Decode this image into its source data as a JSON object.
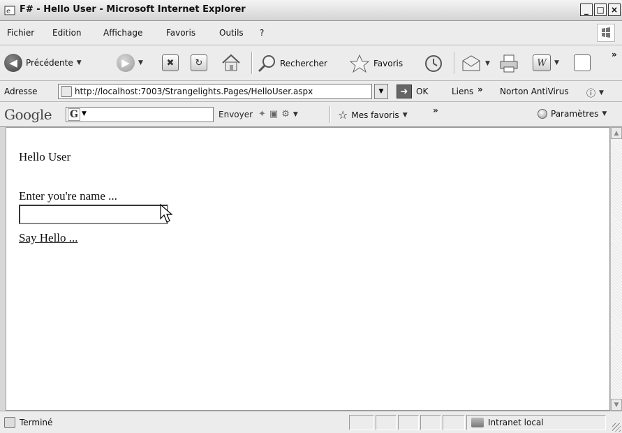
{
  "window": {
    "title": "F# - Hello User - Microsoft Internet Explorer",
    "controls": {
      "minimize": "_",
      "maximize": "□",
      "close": "×"
    }
  },
  "menu": [
    "Fichier",
    "Edition",
    "Affichage",
    "Favoris",
    "Outils",
    "?"
  ],
  "toolbar": {
    "back": "Précédente",
    "search": "Rechercher",
    "favorites": "Favoris",
    "overflow": "»"
  },
  "address": {
    "label": "Adresse",
    "url": "http://localhost:7003/Strangelights.Pages/HelloUser.aspx",
    "go": "OK",
    "links": "Liens",
    "links_more": "»",
    "norton": "Norton AntiVirus"
  },
  "google_toolbar": {
    "logo": "Google",
    "search_mark": "G",
    "send": "Envoyer",
    "favorites": "Mes favoris",
    "more": "»",
    "settings": "Paramètres"
  },
  "page": {
    "heading": "Hello User",
    "prompt": "Enter you're name ...",
    "input_value": "",
    "link": "Say Hello ..."
  },
  "status": {
    "text": "Terminé",
    "zone": "Intranet local"
  },
  "icons": {
    "back": "back-arrow-icon",
    "forward": "forward-arrow-icon",
    "stop": "stop-icon",
    "refresh": "refresh-icon",
    "home": "home-icon",
    "search": "search-magnifier-icon",
    "favorites": "favorites-star-icon",
    "history": "history-icon",
    "mail": "mail-icon",
    "print": "print-icon",
    "word": "word-icon"
  }
}
